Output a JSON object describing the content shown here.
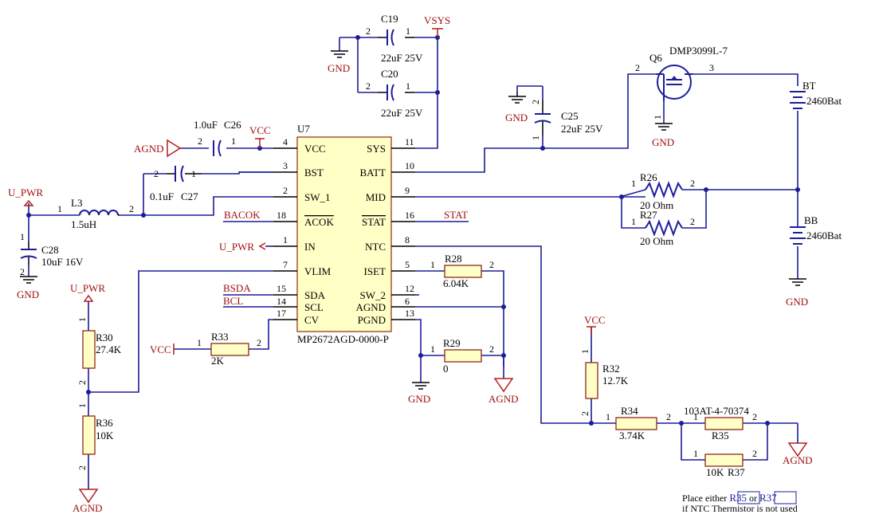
{
  "ic": {
    "ref": "U7",
    "part": "MP2672AGD-0000-P",
    "left_pins": [
      {
        "num": "4",
        "name": "VCC"
      },
      {
        "num": "3",
        "name": "BST"
      },
      {
        "num": "2",
        "name": "SW_1"
      },
      {
        "num": "18",
        "name": "ACOK"
      },
      {
        "num": "1",
        "name": "IN"
      },
      {
        "num": "7",
        "name": "VLIM"
      },
      {
        "num": "15",
        "name": "SDA"
      },
      {
        "num": "14",
        "name": "SCL"
      },
      {
        "num": "17",
        "name": "CV"
      }
    ],
    "right_pins": [
      {
        "num": "11",
        "name": "SYS"
      },
      {
        "num": "10",
        "name": "BATT"
      },
      {
        "num": "9",
        "name": "MID"
      },
      {
        "num": "16",
        "name": "STAT"
      },
      {
        "num": "8",
        "name": "NTC"
      },
      {
        "num": "5",
        "name": "ISET"
      },
      {
        "num": "12",
        "name": "SW_2"
      },
      {
        "num": "6",
        "name": "AGND"
      },
      {
        "num": "13",
        "name": "PGND"
      }
    ]
  },
  "nets": {
    "vsys": "VSYS",
    "vcc": "VCC",
    "agnd": "AGND",
    "gnd": "GND",
    "u_pwr": "U_PWR",
    "bacok": "BACOK",
    "stat": "STAT",
    "bsda": "BSDA",
    "bcl": "BCL"
  },
  "parts": {
    "c19": {
      "ref": "C19",
      "value": "22uF 25V"
    },
    "c20": {
      "ref": "C20",
      "value": "22uF 25V"
    },
    "c26": {
      "ref": "C26",
      "value": "1.0uF"
    },
    "c27": {
      "ref": "C27",
      "value": "0.1uF"
    },
    "c28": {
      "ref": "C28",
      "value": "10uF 16V"
    },
    "c25": {
      "ref": "C25",
      "value": "22uF 25V"
    },
    "l3": {
      "ref": "L3",
      "value": "1.5uH"
    },
    "q6": {
      "ref": "Q6",
      "value": "DMP3099L-7"
    },
    "bt": {
      "ref": "BT",
      "value": "2460Bat"
    },
    "bb": {
      "ref": "BB",
      "value": "2460Bat"
    },
    "r26": {
      "ref": "R26",
      "value": "20 Ohm"
    },
    "r27": {
      "ref": "R27",
      "value": "20 Ohm"
    },
    "r28": {
      "ref": "R28",
      "value": "6.04K"
    },
    "r29": {
      "ref": "R29",
      "value": "0"
    },
    "r30": {
      "ref": "R30",
      "value": "27.4K"
    },
    "r36": {
      "ref": "R36",
      "value": "10K"
    },
    "r33": {
      "ref": "R33",
      "value": "2K"
    },
    "r32": {
      "ref": "R32",
      "value": "12.7K"
    },
    "r34": {
      "ref": "R34",
      "value": "3.74K"
    },
    "r35": {
      "ref": "R35",
      "value": "103AT-4-70374"
    },
    "r37": {
      "ref": "R37",
      "value": "10K"
    }
  },
  "pins": {
    "p1": "1",
    "p2": "2",
    "p3": "3"
  },
  "note": {
    "line1_pre": "Place either ",
    "line1_mid": " or ",
    "link1": "R35",
    "link2": "R37",
    "line2": "if NTC Thermistor is not used"
  }
}
